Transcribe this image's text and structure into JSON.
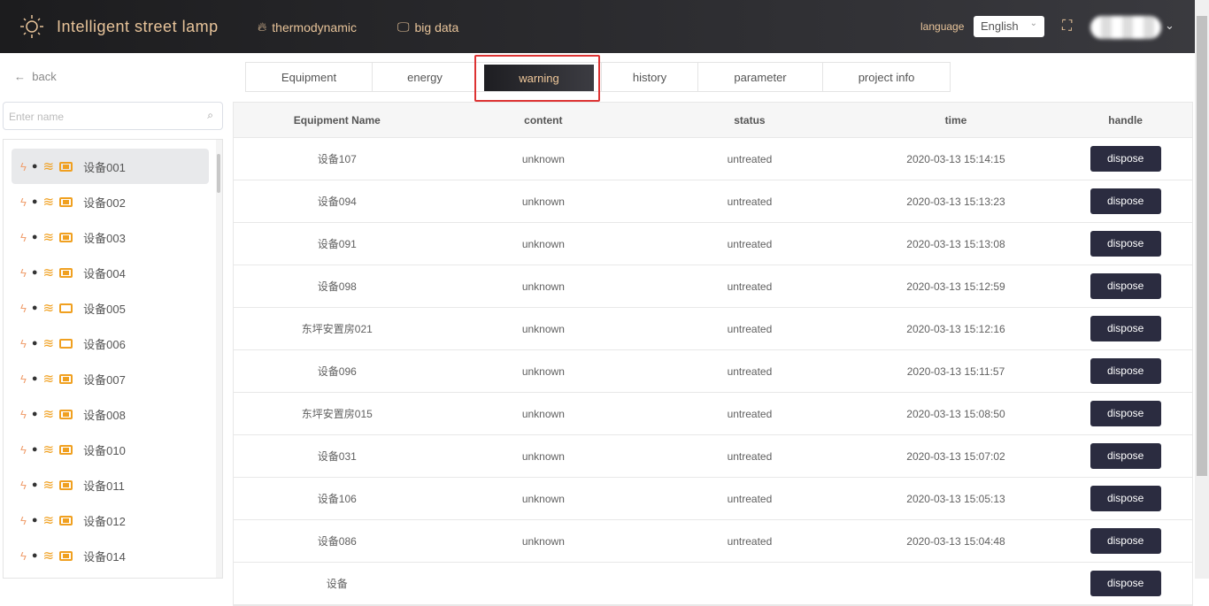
{
  "header": {
    "title": "Intelligent street lamp",
    "nav": [
      {
        "label": "thermodynamic",
        "icon": "flame-icon"
      },
      {
        "label": "big data",
        "icon": "monitor-icon"
      }
    ],
    "language_label": "language",
    "language_value": "English"
  },
  "sidebar": {
    "back": "back",
    "search_placeholder": "Enter name",
    "items": [
      {
        "label": "设备001",
        "battery": "full"
      },
      {
        "label": "设备002",
        "battery": "full"
      },
      {
        "label": "设备003",
        "battery": "full"
      },
      {
        "label": "设备004",
        "battery": "full"
      },
      {
        "label": "设备005",
        "battery": "empty"
      },
      {
        "label": "设备006",
        "battery": "empty"
      },
      {
        "label": "设备007",
        "battery": "full"
      },
      {
        "label": "设备008",
        "battery": "full"
      },
      {
        "label": "设备010",
        "battery": "full"
      },
      {
        "label": "设备011",
        "battery": "full"
      },
      {
        "label": "设备012",
        "battery": "full"
      },
      {
        "label": "设备014",
        "battery": "full"
      }
    ]
  },
  "tabs": [
    "Equipment",
    "energy",
    "warning",
    "history",
    "parameter",
    "project info"
  ],
  "table": {
    "headers": [
      "Equipment Name",
      "content",
      "status",
      "time",
      "handle"
    ],
    "button": "dispose",
    "rows": [
      [
        "设备107",
        "unknown",
        "untreated",
        "2020-03-13 15:14:15"
      ],
      [
        "设备094",
        "unknown",
        "untreated",
        "2020-03-13 15:13:23"
      ],
      [
        "设备091",
        "unknown",
        "untreated",
        "2020-03-13 15:13:08"
      ],
      [
        "设备098",
        "unknown",
        "untreated",
        "2020-03-13 15:12:59"
      ],
      [
        "东坪安置房021",
        "unknown",
        "untreated",
        "2020-03-13 15:12:16"
      ],
      [
        "设备096",
        "unknown",
        "untreated",
        "2020-03-13 15:11:57"
      ],
      [
        "东坪安置房015",
        "unknown",
        "untreated",
        "2020-03-13 15:08:50"
      ],
      [
        "设备031",
        "unknown",
        "untreated",
        "2020-03-13 15:07:02"
      ],
      [
        "设备106",
        "unknown",
        "untreated",
        "2020-03-13 15:05:13"
      ],
      [
        "设备086",
        "unknown",
        "untreated",
        "2020-03-13 15:04:48"
      ],
      [
        "设备",
        "",
        "",
        "",
        ""
      ]
    ]
  }
}
